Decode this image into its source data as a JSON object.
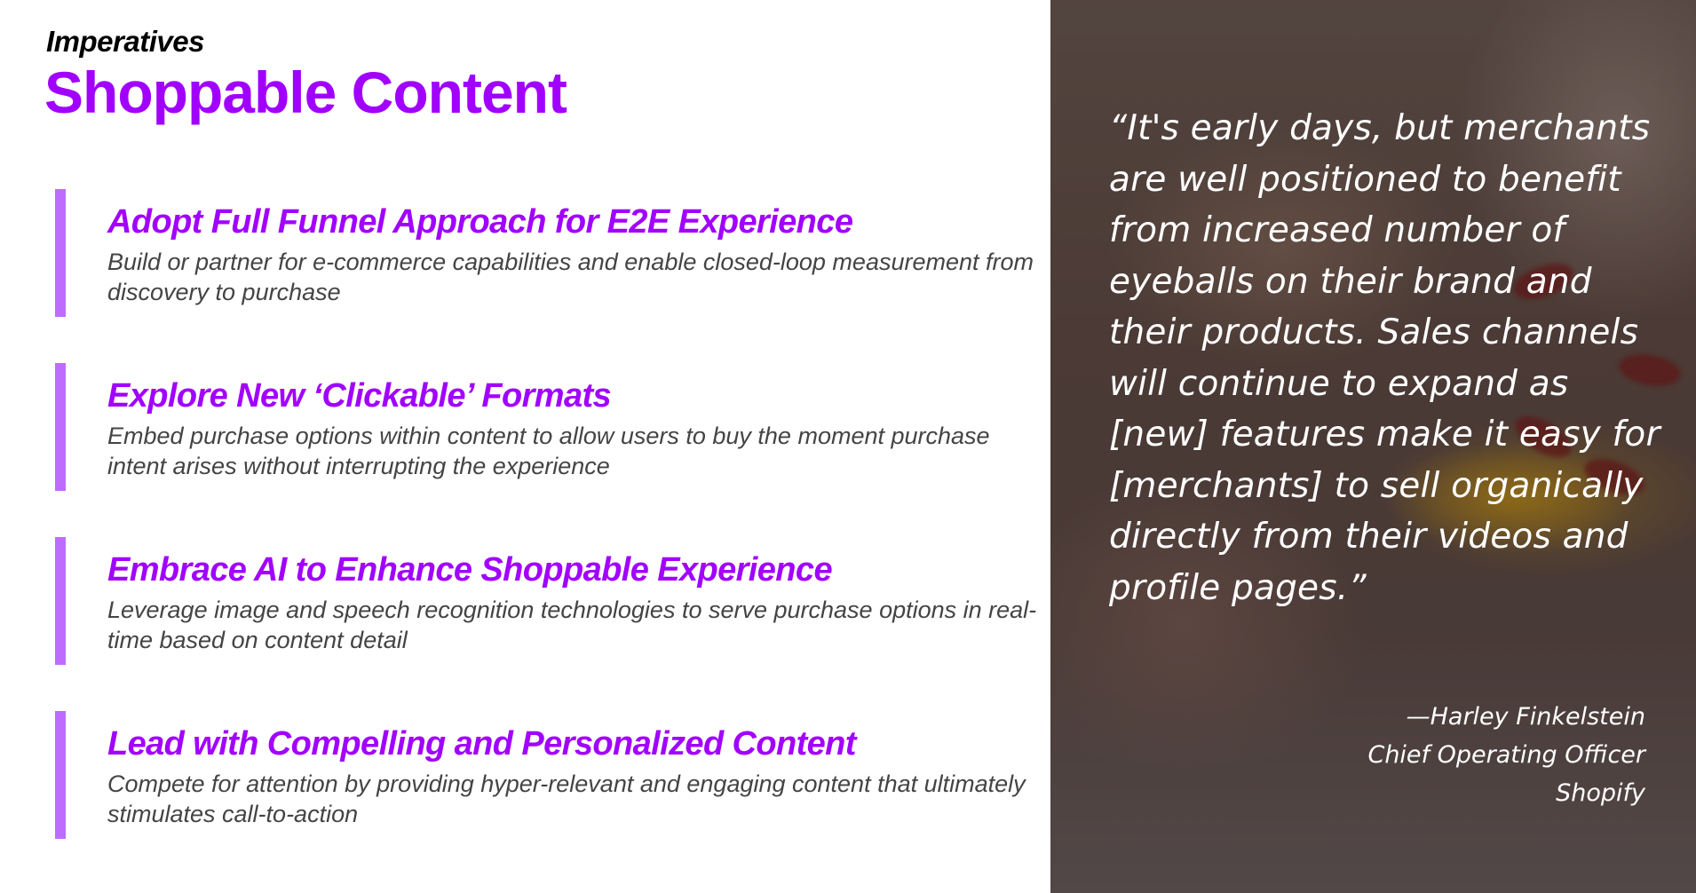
{
  "header": {
    "eyebrow": "Imperatives",
    "title": "Shoppable Content"
  },
  "imperatives": [
    {
      "heading": "Adopt Full Funnel Approach for E2E Experience",
      "body": "Build or partner for e-commerce capabilities and enable closed-loop measurement from discovery to purchase"
    },
    {
      "heading": "Explore New ‘Clickable’ Formats",
      "body": "Embed purchase options within content to allow users to buy the moment purchase intent arises without interrupting the experience"
    },
    {
      "heading": "Embrace AI to Enhance Shoppable Experience",
      "body": "Leverage image and speech recognition technologies to serve purchase options in real-time based on content detail"
    },
    {
      "heading": "Lead with Compelling and Personalized Content",
      "body": "Compete for attention by providing hyper-relevant and engaging content that ultimately stimulates call-to-action"
    }
  ],
  "quote": {
    "text": "“It's early days, but merchants are well positioned to benefit from increased number of eyeballs on their brand and their products. Sales channels will continue to expand as [new] features make it easy for [merchants] to sell organically directly from their videos and profile pages.”",
    "author": "—Harley Finkelstein",
    "role": "Chief Operating Officer",
    "company": "Shopify"
  },
  "colors": {
    "accent": "#a100ff",
    "bar": "#be6cff",
    "body_text": "#444444"
  }
}
